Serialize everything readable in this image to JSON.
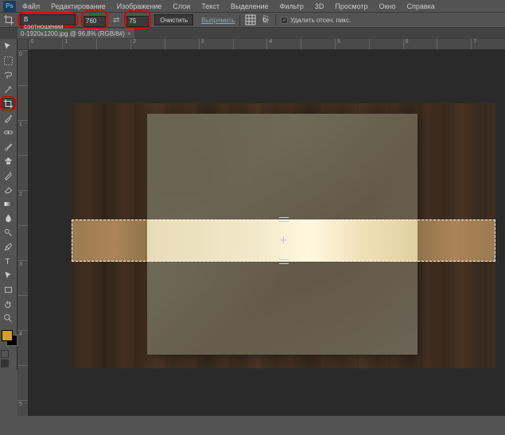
{
  "app": {
    "logo": "Ps"
  },
  "menu": {
    "items": [
      "Файл",
      "Редактирование",
      "Изображение",
      "Слои",
      "Текст",
      "Выделение",
      "Фильтр",
      "3D",
      "Просмотр",
      "Окно",
      "Справка"
    ]
  },
  "options": {
    "mode_label": "В соотношении",
    "width": "760",
    "height": "75",
    "clear_btn": "Очистить",
    "straighten_link": "Выпрямить",
    "delete_pixels_label": "Удалить отсеч. пикс."
  },
  "tab": {
    "title": "0-1920x1200.jpg @ 96,8% (RGB/8#)"
  },
  "ruler_h": [
    "0",
    "1",
    "",
    "2",
    "",
    "3",
    "",
    "4",
    "",
    "5",
    "",
    "6",
    "",
    "7"
  ],
  "ruler_v": [
    "0",
    "",
    "1",
    "",
    "2",
    "",
    "3",
    "",
    "4",
    "",
    "5"
  ],
  "colors": {
    "foreground": "#d4a020",
    "background": "#000000"
  }
}
